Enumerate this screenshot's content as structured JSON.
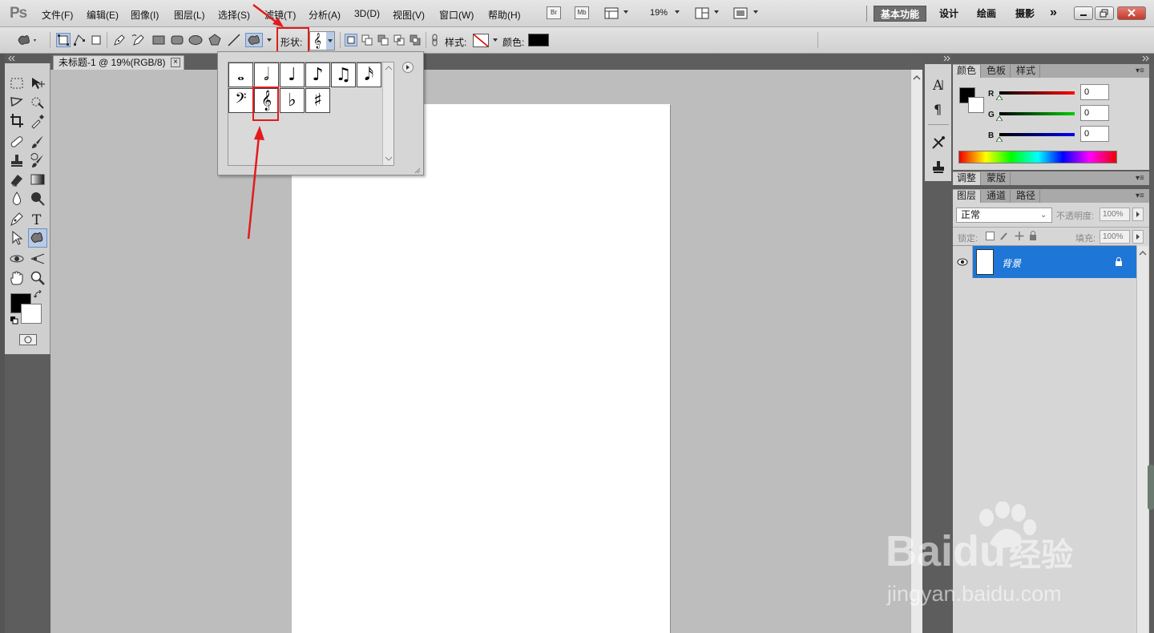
{
  "menubar": {
    "logo": "Ps",
    "items": [
      "文件(F)",
      "编辑(E)",
      "图像(I)",
      "图层(L)",
      "选择(S)",
      "滤镜(T)",
      "分析(A)",
      "3D(D)",
      "视图(V)",
      "窗口(W)",
      "帮助(H)"
    ],
    "bridge_button": "Br",
    "minibridge_button": "Mb",
    "zoom": "19%",
    "workspaces": [
      "基本功能",
      "设计",
      "绘画",
      "摄影"
    ],
    "more": "»"
  },
  "options": {
    "shape_label": "形状:",
    "style_label": "样式:",
    "color_label": "颜色:",
    "selected_shape": "𝄞"
  },
  "document": {
    "tab_title": "未标题-1 @ 19%(RGB/8)",
    "close": "×"
  },
  "shape_picker": {
    "shapes": [
      "𝅝",
      "𝅗𝅥",
      "♩",
      "♪",
      "♫",
      "𝅘𝅥𝅯",
      "𝄢",
      "𝄞",
      "♭",
      "♯"
    ],
    "selected_index": 7
  },
  "color_panel": {
    "tabs": [
      "颜色",
      "色板",
      "样式"
    ],
    "channels": [
      {
        "label": "R",
        "value": "0"
      },
      {
        "label": "G",
        "value": "0"
      },
      {
        "label": "B",
        "value": "0"
      }
    ]
  },
  "adjust_panel": {
    "tabs": [
      "调整",
      "蒙版"
    ]
  },
  "layers_panel": {
    "tabs": [
      "图层",
      "通道",
      "路径"
    ],
    "blend_mode": "正常",
    "opacity_label": "不透明度:",
    "opacity": "100%",
    "lock_label": "锁定:",
    "fill_label": "填充:",
    "fill": "100%",
    "layer_name": "背景"
  },
  "watermark": {
    "brand_a": "Bai",
    "brand_b": "du",
    "brand_c": "经验",
    "url": "jingyan.baidu.com"
  }
}
